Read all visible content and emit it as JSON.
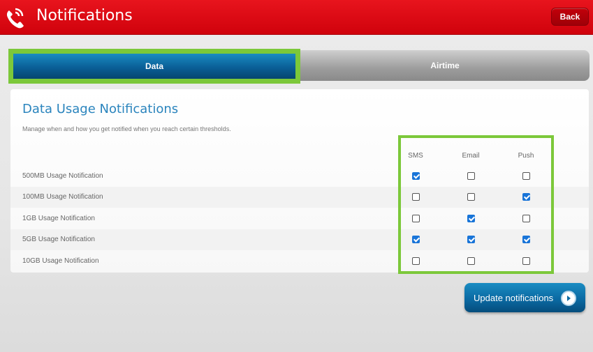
{
  "header": {
    "title": "Notifications",
    "back_label": "Back"
  },
  "tabs": [
    {
      "label": "Data",
      "active": true
    },
    {
      "label": "Airtime",
      "active": false
    }
  ],
  "panel": {
    "title": "Data Usage Notifications",
    "description": "Manage when and how you get notified when you reach certain thresholds."
  },
  "columns": [
    "SMS",
    "Email",
    "Push"
  ],
  "rows": [
    {
      "label": "500MB Usage Notification",
      "sms": true,
      "email": false,
      "push": false
    },
    {
      "label": "100MB Usage Notification",
      "sms": false,
      "email": false,
      "push": true
    },
    {
      "label": "1GB Usage Notification",
      "sms": false,
      "email": true,
      "push": false
    },
    {
      "label": "5GB Usage Notification",
      "sms": true,
      "email": true,
      "push": true
    },
    {
      "label": "10GB Usage Notification",
      "sms": false,
      "email": false,
      "push": false
    }
  ],
  "actions": {
    "update_label": "Update notifications"
  },
  "colors": {
    "brand_red": "#d0020c",
    "accent_blue": "#0b6aa3",
    "highlight_green": "#7cc83a"
  }
}
